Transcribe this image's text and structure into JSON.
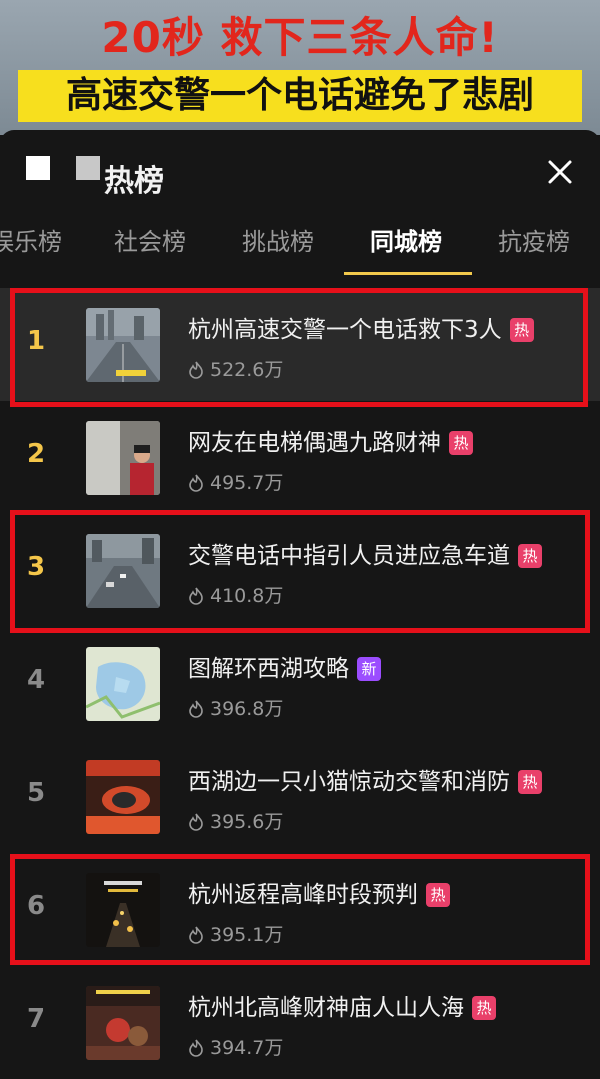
{
  "banner": {
    "line1": "20秒 救下三条人命!",
    "line2": "高速交警一个电话避免了悲剧"
  },
  "panel": {
    "title": "热榜",
    "close_icon": "close-icon"
  },
  "tabs": [
    {
      "label": "娱乐榜",
      "active": false
    },
    {
      "label": "社会榜",
      "active": false
    },
    {
      "label": "挑战榜",
      "active": false
    },
    {
      "label": "同城榜",
      "active": true
    },
    {
      "label": "抗疫榜",
      "active": false
    }
  ],
  "items": [
    {
      "rank": "1",
      "title": "杭州高速交警一个电话救下3人",
      "badge": "热",
      "heat": "522.6万",
      "highlighted": true
    },
    {
      "rank": "2",
      "title": "网友在电梯偶遇九路财神",
      "badge": "热",
      "heat": "495.7万",
      "highlighted": false
    },
    {
      "rank": "3",
      "title": "交警电话中指引人员进应急车道",
      "badge": "热",
      "heat": "410.8万",
      "highlighted": true
    },
    {
      "rank": "4",
      "title": "图解环西湖攻略",
      "badge": "新",
      "heat": "396.8万",
      "highlighted": false
    },
    {
      "rank": "5",
      "title": "西湖边一只小猫惊动交警和消防",
      "badge": "热",
      "heat": "395.6万",
      "highlighted": false
    },
    {
      "rank": "6",
      "title": "杭州返程高峰时段预判",
      "badge": "热",
      "heat": "395.1万",
      "highlighted": true
    },
    {
      "rank": "7",
      "title": "杭州北高峰财神庙人山人海",
      "badge": "热",
      "heat": "394.7万",
      "highlighted": false
    }
  ],
  "colors": {
    "hot_badge": "#e9406a",
    "new_badge": "#9b4dff",
    "rank_gold": "#f4c64a",
    "highlight_box": "#e6101a",
    "tab_underline": "#f2c94c"
  }
}
